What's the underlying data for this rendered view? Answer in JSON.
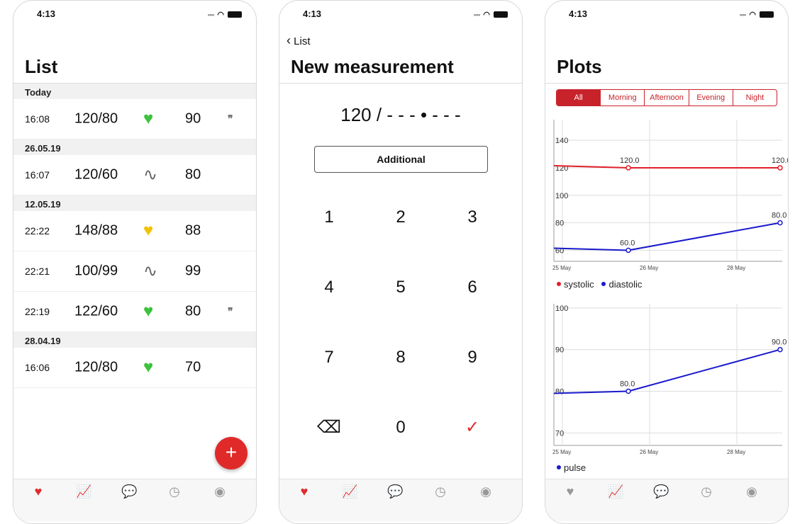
{
  "status": {
    "time": "4:13"
  },
  "list_screen": {
    "title": "List",
    "sections": [
      {
        "label": "Today",
        "rows": [
          {
            "time": "16:08",
            "bp": "120/80",
            "icon": "heart-green",
            "pulse": "90",
            "note": true
          }
        ]
      },
      {
        "label": "26.05.19",
        "rows": [
          {
            "time": "16:07",
            "bp": "120/60",
            "icon": "pulse-wave",
            "pulse": "80",
            "note": false
          }
        ]
      },
      {
        "label": "12.05.19",
        "rows": [
          {
            "time": "22:22",
            "bp": "148/88",
            "icon": "heart-yellow",
            "pulse": "88",
            "note": false
          },
          {
            "time": "22:21",
            "bp": "100/99",
            "icon": "pulse-wave",
            "pulse": "99",
            "note": false
          },
          {
            "time": "22:19",
            "bp": "122/60",
            "icon": "heart-green",
            "pulse": "80",
            "note": true
          }
        ]
      },
      {
        "label": "28.04.19",
        "rows": [
          {
            "time": "16:06",
            "bp": "120/80",
            "icon": "heart-green",
            "pulse": "70",
            "note": false
          }
        ]
      }
    ],
    "fab": "+"
  },
  "measure_screen": {
    "back": "List",
    "title": "New measurement",
    "entry": "120 / - - - • - - -",
    "additional": "Additional",
    "keys": [
      "1",
      "2",
      "3",
      "4",
      "5",
      "6",
      "7",
      "8",
      "9",
      "⌫",
      "0",
      "✓"
    ]
  },
  "plots_screen": {
    "title": "Plots",
    "segments": [
      "All",
      "Morning",
      "Afternoon",
      "Evening",
      "Night"
    ],
    "selected_segment": "All"
  },
  "tabs": [
    "add-measurement",
    "plots",
    "notes",
    "history",
    "profile"
  ],
  "colors": {
    "accent": "#e02a2a",
    "green": "#3cc23c",
    "yellow": "#f2c200",
    "systolic": "#e0202a",
    "diastolic": "#1a1acc"
  },
  "chart_data": [
    {
      "type": "line",
      "xticks": [
        "25 May",
        "26 May",
        "28 May"
      ],
      "ylim": [
        52,
        155
      ],
      "yticks": [
        60,
        80,
        100,
        120,
        140
      ],
      "grid": true,
      "legend": "bottom-left",
      "series": [
        {
          "name": "systolic",
          "color": "#e0202a",
          "points": [
            {
              "x": "26 May 16:07",
              "y": 120,
              "label": "120.0"
            },
            {
              "x": "Today 16:08",
              "y": 120,
              "label": "120.0"
            }
          ]
        },
        {
          "name": "diastolic",
          "color": "#1a1acc",
          "points": [
            {
              "x": "26 May 16:07",
              "y": 60,
              "label": "60.0"
            },
            {
              "x": "Today 16:08",
              "y": 80,
              "label": "80.0"
            }
          ]
        }
      ]
    },
    {
      "type": "line",
      "xticks": [
        "25 May",
        "26 May",
        "28 May"
      ],
      "ylim": [
        67,
        101
      ],
      "yticks": [
        70,
        80,
        90,
        100
      ],
      "grid": true,
      "legend": "bottom-left",
      "series": [
        {
          "name": "pulse",
          "color": "#1a1acc",
          "points": [
            {
              "x": "26 May 16:07",
              "y": 80,
              "label": "80.0"
            },
            {
              "x": "Today 16:08",
              "y": 90,
              "label": "90.0"
            }
          ]
        }
      ]
    }
  ]
}
